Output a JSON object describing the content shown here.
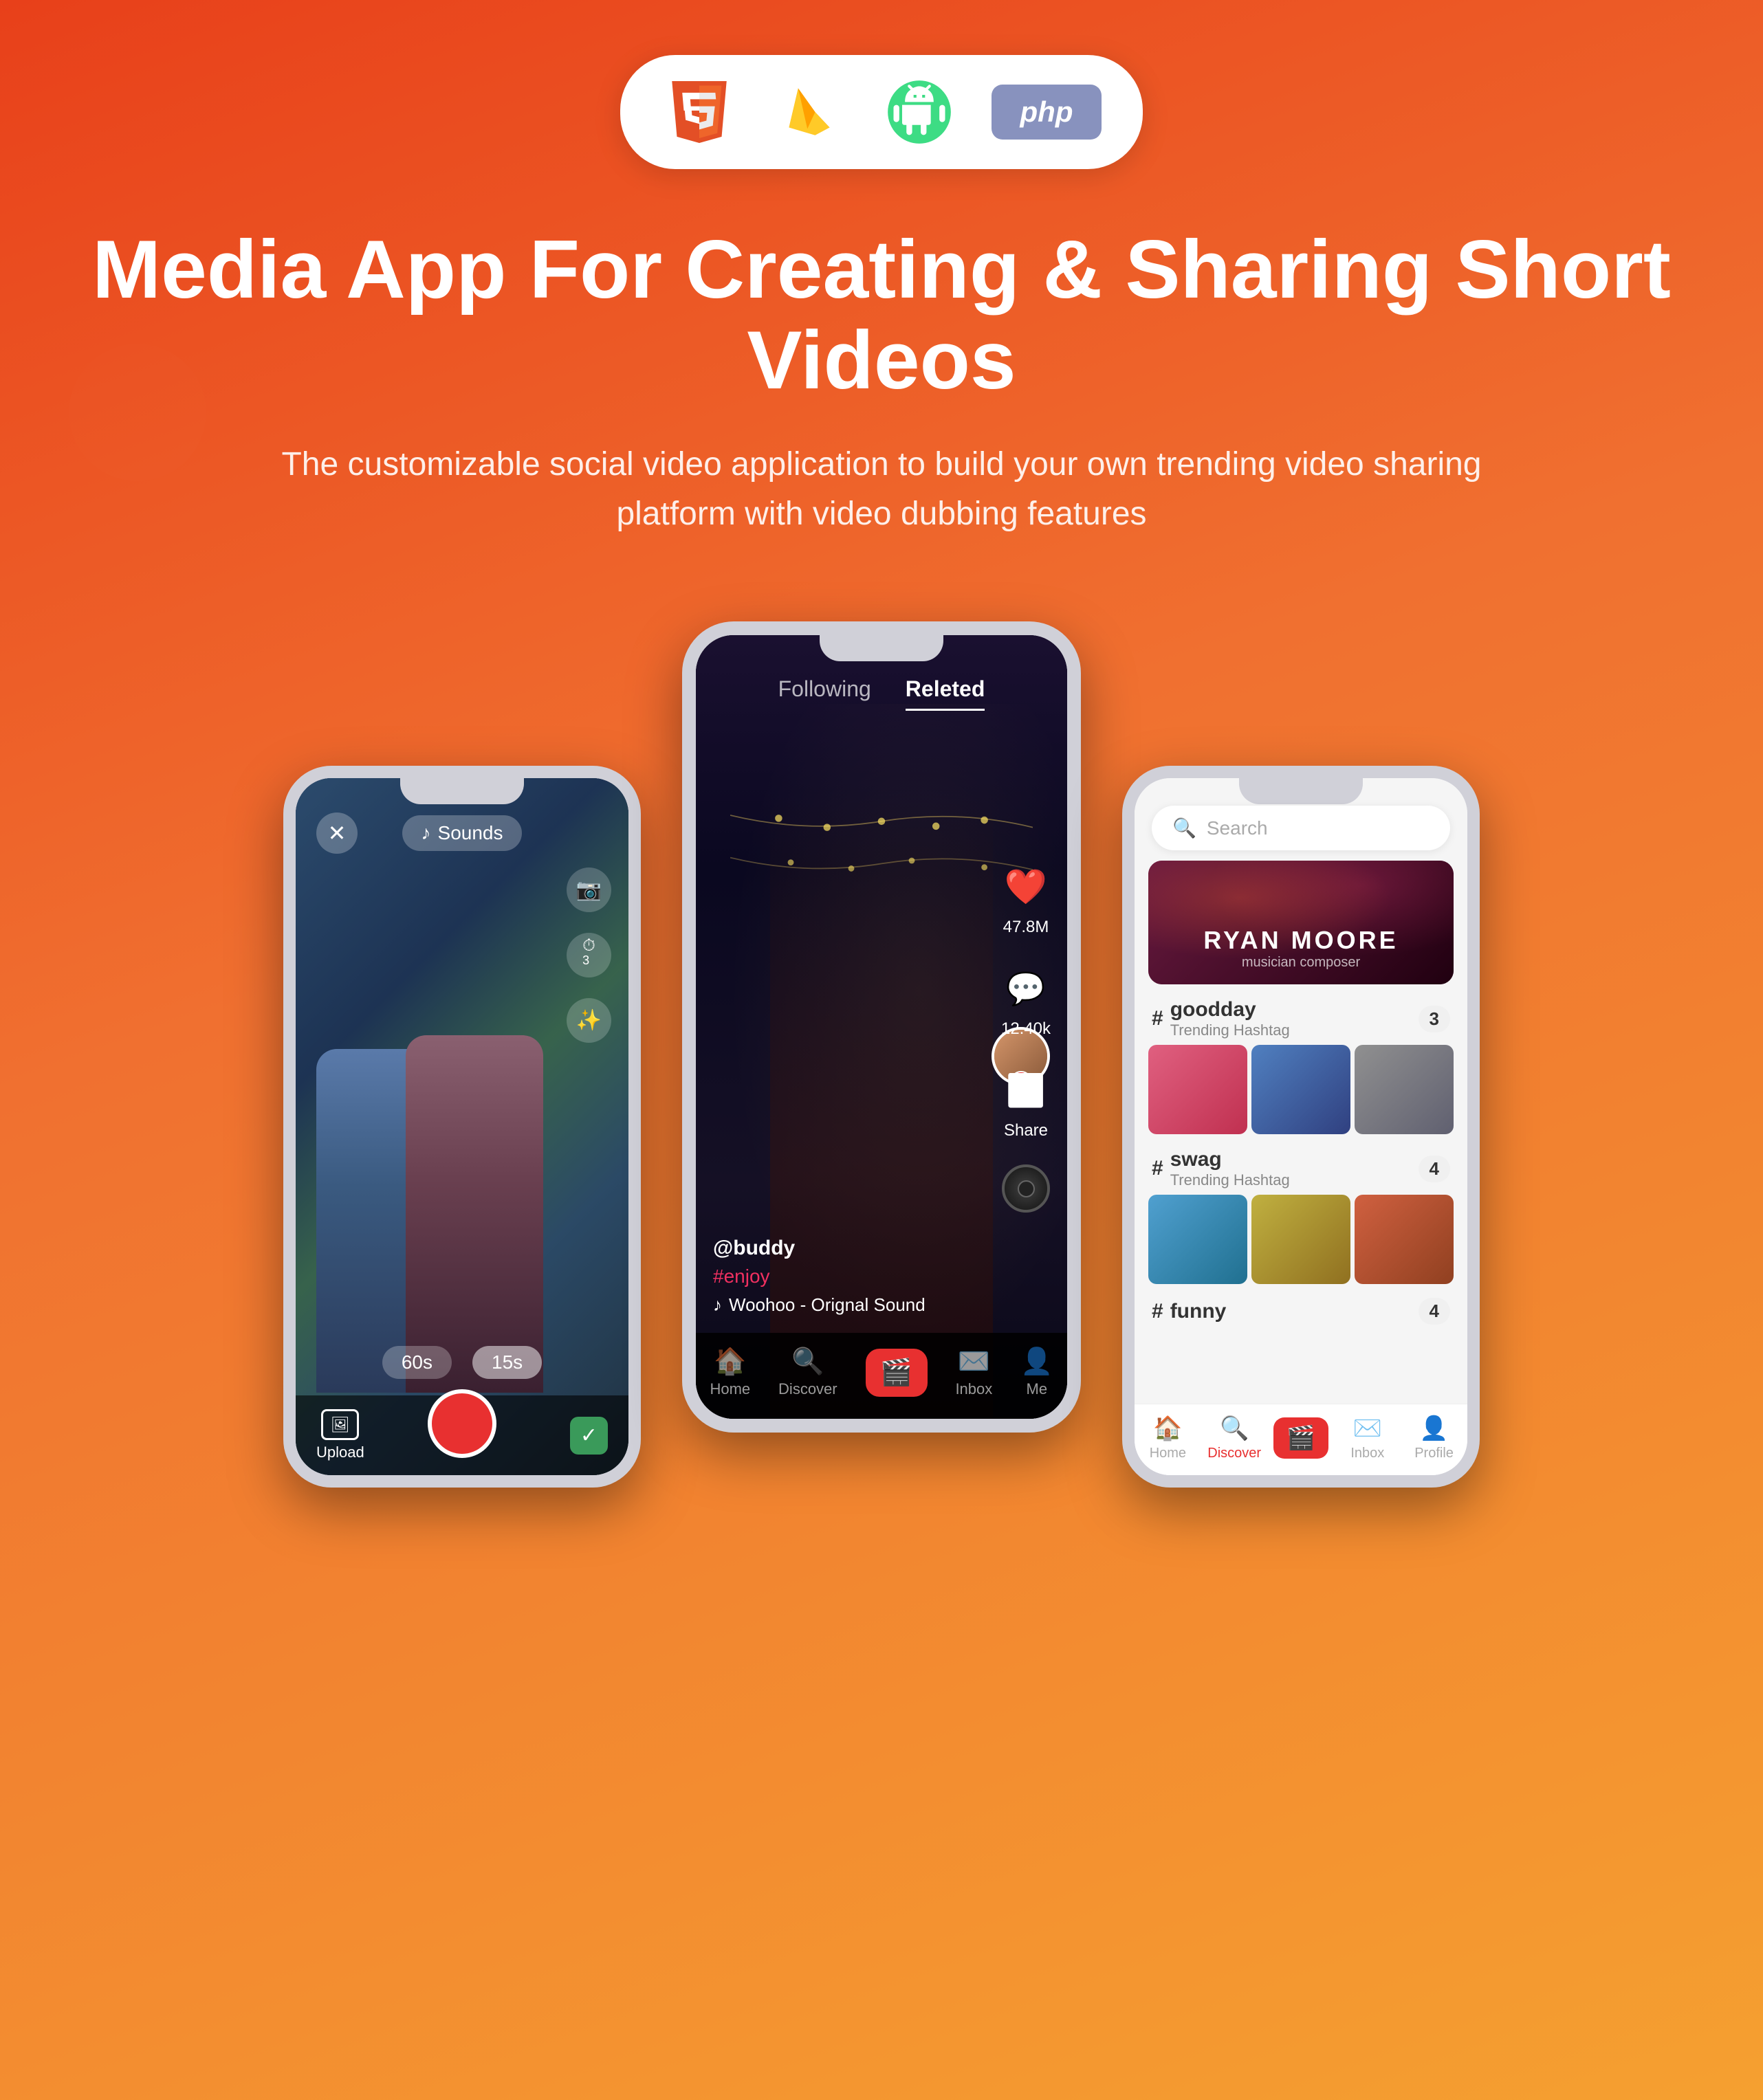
{
  "page": {
    "title": "Media App For Creating & Sharing Short Videos",
    "subtitle": "The customizable social video application to build your own trending video sharing platform with video dubbing features"
  },
  "tech_badges": {
    "html5": {
      "label": "HTML5",
      "color": "#e34f26"
    },
    "firebase": {
      "label": "Firebase",
      "color": "#f5a623"
    },
    "android": {
      "label": "Android",
      "color": "#3ddc84"
    },
    "php": {
      "label": "php",
      "color": "#8892be"
    }
  },
  "phone_left": {
    "sounds_label": "Sounds",
    "time_60s": "60s",
    "time_15s": "15s",
    "upload_label": "Upload"
  },
  "phone_middle": {
    "tab_following": "Following",
    "tab_related": "Releted",
    "username": "@buddy",
    "hashtag": "#enjoy",
    "sound": "Woohoo - Orignal Sound",
    "likes": "47.8M",
    "comments": "12.40k",
    "share_label": "Share",
    "nav_home": "Home",
    "nav_discover": "Discover",
    "nav_inbox": "Inbox",
    "nav_me": "Me"
  },
  "phone_right": {
    "search_placeholder": "Search",
    "banner_name": "RYAN MOORE",
    "banner_sub": "musician  composer",
    "hashtag1_name": "goodday",
    "hashtag1_label": "Trending Hashtag",
    "hashtag1_count": "3",
    "hashtag2_name": "swag",
    "hashtag2_label": "Trending Hashtag",
    "hashtag2_count": "4",
    "hashtag3_name": "funny",
    "hashtag3_count": "4",
    "nav_home": "Home",
    "nav_discover": "Discover",
    "nav_inbox": "Inbox",
    "nav_profile": "Profile"
  }
}
